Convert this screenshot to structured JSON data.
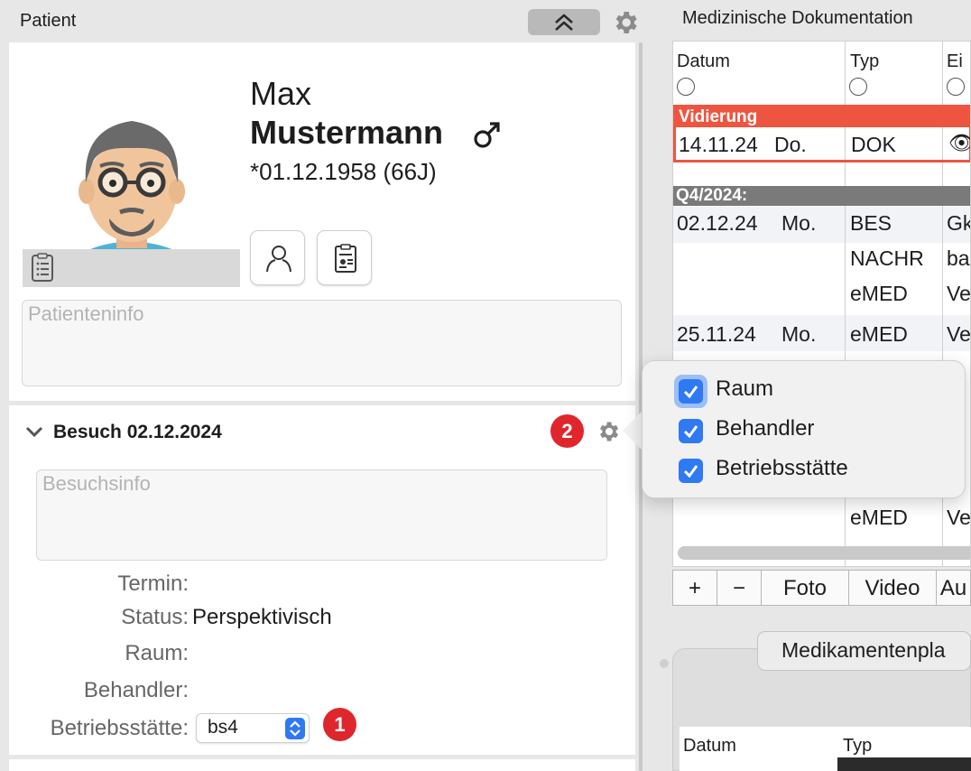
{
  "left": {
    "title": "Patient",
    "patient": {
      "first_name": "Max",
      "last_name": "Mustermann",
      "dob": "*01.12.1958 (66J)",
      "info_placeholder": "Patienteninfo"
    },
    "visit": {
      "title": "Besuch 02.12.2024",
      "info_placeholder": "Besuchsinfo",
      "fields": {
        "termin_label": "Termin:",
        "status_label": "Status:",
        "status_value": "Perspektivisch",
        "raum_label": "Raum:",
        "behandler_label": "Behandler:",
        "betrieb_label": "Betriebsstätte:",
        "betrieb_value": "bs4"
      },
      "badge1": "1",
      "badge2": "2"
    }
  },
  "right": {
    "title": "Medizinische Dokumentation",
    "columns": [
      "Datum",
      "Typ",
      "Ei"
    ],
    "vid_header": "Vidierung",
    "vid_row": {
      "date": "14.11.24",
      "day": "Do.",
      "typ": "DOK",
      "icon": "👁"
    },
    "quarter_header": "Q4/2024:",
    "rows": [
      {
        "date": "02.12.24",
        "day": "Mo.",
        "typ": "BES",
        "ein": "Gk"
      },
      {
        "date": "",
        "day": "",
        "typ": "NACHR",
        "ein": "ba"
      },
      {
        "date": "",
        "day": "",
        "typ": "eMED",
        "ein": "Ve"
      },
      {
        "date": "25.11.24",
        "day": "Mo.",
        "typ": "eMED",
        "ein": "Ve"
      }
    ],
    "row_partial": {
      "typ": "eMED",
      "ein": "Ve"
    },
    "bottom_bar": {
      "add": "+",
      "remove": "−",
      "foto": "Foto",
      "video": "Video",
      "au": "Au"
    },
    "med_tab": "Medikamentenpla",
    "med_columns": [
      "Datum",
      "Typ"
    ]
  },
  "popover": {
    "items": [
      {
        "label": "Raum",
        "checked": true
      },
      {
        "label": "Behandler",
        "checked": true
      },
      {
        "label": "Betriebsstätte",
        "checked": true
      }
    ]
  },
  "colors": {
    "accent": "#2f79f3",
    "badge": "#e0262d",
    "vidierung": "#ee5540"
  }
}
